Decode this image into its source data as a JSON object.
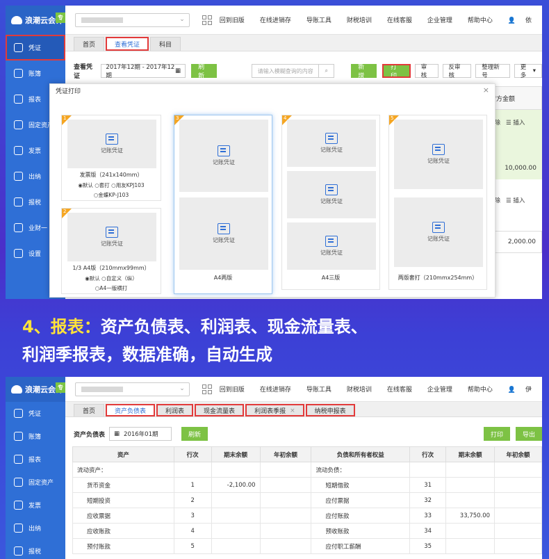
{
  "app": {
    "logo": "浪潮云会计",
    "logo_tag": "专",
    "company_select_chevron": "⌄"
  },
  "top_menu": [
    "回到旧版",
    "在线进销存",
    "导账工具",
    "财税培训",
    "在线客服",
    "企业管理",
    "帮助中心"
  ],
  "top_user_1": "依",
  "top_user_2": "伊",
  "sidebar_1": [
    {
      "label": "凭证",
      "icon": "voucher-icon"
    },
    {
      "label": "账簿",
      "icon": "ledger-icon"
    },
    {
      "label": "报表",
      "icon": "report-icon"
    },
    {
      "label": "固定资产",
      "icon": "asset-icon"
    },
    {
      "label": "发票",
      "icon": "invoice-icon"
    },
    {
      "label": "出纳",
      "icon": "cashier-icon"
    },
    {
      "label": "报税",
      "icon": "tax-icon"
    },
    {
      "label": "业财一",
      "icon": "business-icon"
    },
    {
      "label": "设置",
      "icon": "settings-icon"
    }
  ],
  "sidebar_2": [
    {
      "label": "凭证"
    },
    {
      "label": "账簿"
    },
    {
      "label": "报表"
    },
    {
      "label": "固定资产"
    },
    {
      "label": "发票"
    },
    {
      "label": "出纳"
    },
    {
      "label": "报税"
    }
  ],
  "shot1": {
    "tabs": [
      "首页",
      "查看凭证",
      "科目"
    ],
    "toolbar_label": "查看凭证",
    "date_range": "2017年12期 - 2017年12期",
    "refresh": "刷新",
    "search_placeholder": "请输入模糊查询的内容",
    "buttons": [
      "新增",
      "打印",
      "审核",
      "反审核",
      "整理新号",
      "更多"
    ],
    "bg": {
      "header": "贷方金额",
      "delete": "删除",
      "insert": "插入",
      "amount1": "10,000.00",
      "amount2": "2,000.00"
    },
    "modal": {
      "title": "凭证打印",
      "close": "×",
      "paper_label": "记账凭证",
      "card1": {
        "num": "1",
        "caption": "发票版（241x140mm）",
        "opt1": "◉默认 ○套打 ○用友KPJ103",
        "opt2": "○金蝶KP-J103"
      },
      "card2": {
        "num": "2",
        "caption": "1/3 A4版（210mmx99mm）",
        "opt1": "◉默认 ○自定义（纵）",
        "opt2": "○A4一版横打"
      },
      "card3": {
        "num": "3",
        "caption": "A4两版"
      },
      "card4": {
        "num": "4",
        "caption": "A4三版"
      },
      "card5": {
        "num": "5",
        "caption": "两版套打（210mmx254mm）"
      }
    }
  },
  "headline": {
    "prefix": "4、报表：",
    "line1": "资产负债表、利润表、现金流量表、",
    "line2": "利润季报表，数据准确，自动生成"
  },
  "shot2": {
    "tabs": [
      "首页",
      "资产负债表",
      "利润表",
      "现金流量表",
      "利润表季报",
      "纳税申报表"
    ],
    "tab_close": "×",
    "toolbar_label": "资产负债表",
    "date": "2016年01期",
    "refresh": "刷新",
    "print": "打印",
    "export": "导出",
    "headers": [
      "资产",
      "行次",
      "期末余额",
      "年初余额",
      "负债和所有者权益",
      "行次",
      "期末余额",
      "年初余额"
    ],
    "rows": [
      [
        "流动资产：",
        "",
        "",
        "",
        "流动负债：",
        "",
        "",
        ""
      ],
      [
        "货币资金",
        "1",
        "-2,100.00",
        "",
        "短期借款",
        "31",
        "",
        ""
      ],
      [
        "短期投资",
        "2",
        "",
        "",
        "应付票据",
        "32",
        "",
        ""
      ],
      [
        "应收票据",
        "3",
        "",
        "",
        "应付账款",
        "33",
        "33,750.00",
        ""
      ],
      [
        "应收账款",
        "4",
        "",
        "",
        "预收账款",
        "34",
        "",
        ""
      ],
      [
        "预付账款",
        "5",
        "",
        "",
        "应付职工薪酬",
        "35",
        "",
        ""
      ]
    ]
  }
}
